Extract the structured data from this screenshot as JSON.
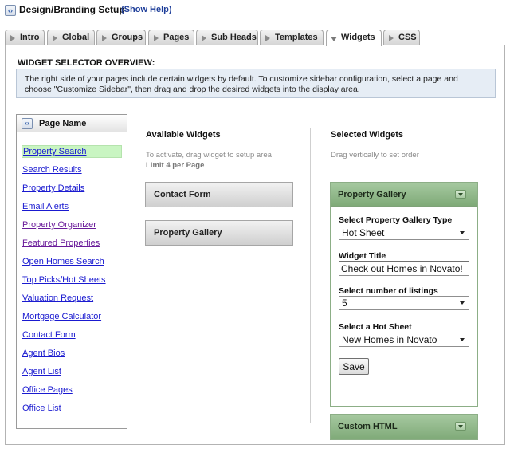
{
  "header": {
    "title": "Design/Branding Setup",
    "help_link": "(Show Help)"
  },
  "tabs": [
    {
      "label": "Intro",
      "active": false
    },
    {
      "label": "Global",
      "active": false
    },
    {
      "label": "Groups",
      "active": false
    },
    {
      "label": "Pages",
      "active": false
    },
    {
      "label": "Sub Heads",
      "active": false
    },
    {
      "label": "Templates",
      "active": false
    },
    {
      "label": "Widgets",
      "active": true
    },
    {
      "label": "CSS",
      "active": false
    }
  ],
  "overview": {
    "title": "WIDGET SELECTOR OVERVIEW:",
    "text": "The right side of your pages include certain widgets by default. To customize sidebar configuration, select a page and choose \"Customize Sidebar\", then drag and drop the desired widgets into the display area."
  },
  "page_list": {
    "title": "Page Name",
    "items": [
      {
        "label": "Property Search",
        "selected": true
      },
      {
        "label": "Search Results"
      },
      {
        "label": "Property Details"
      },
      {
        "label": "Email Alerts"
      },
      {
        "label": "Property Organizer",
        "visited": true
      },
      {
        "label": "Featured Properties",
        "visited": true
      },
      {
        "label": "Open Homes Search"
      },
      {
        "label": "Top Picks/Hot Sheets"
      },
      {
        "label": "Valuation Request"
      },
      {
        "label": "Mortgage Calculator"
      },
      {
        "label": "Contact Form"
      },
      {
        "label": "Agent Bios"
      },
      {
        "label": "Agent List"
      },
      {
        "label": "Office Pages"
      },
      {
        "label": "Office List"
      }
    ]
  },
  "available": {
    "title": "Available Widgets",
    "hint": "To activate, drag widget to setup area",
    "limit": "Limit 4 per Page",
    "widgets": [
      "Contact Form",
      "Property Gallery"
    ]
  },
  "selected": {
    "title": "Selected Widgets",
    "hint": "Drag vertically to set order",
    "gallery": {
      "title": "Property Gallery",
      "type_label": "Select Property Gallery Type",
      "type_value": "Hot Sheet",
      "widget_title_label": "Widget Title",
      "widget_title_value": "Check out Homes in Novato!",
      "listings_label": "Select number of listings",
      "listings_value": "5",
      "hotsheet_label": "Select a Hot Sheet",
      "hotsheet_value": "New Homes in Novato",
      "save_label": "Save"
    },
    "custom_html": {
      "title": "Custom HTML"
    }
  },
  "colors": {
    "link": "#1a1ad0",
    "visited_link": "#6a1b9a",
    "selected_item_bg": "#c9f5c2",
    "widget_header_green": "#8fb889",
    "overview_bg": "#e6edf5"
  }
}
